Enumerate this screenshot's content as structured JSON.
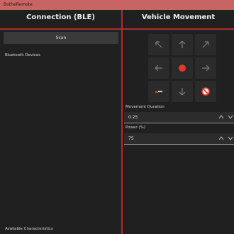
{
  "window": {
    "title": "BotheRemote"
  },
  "connection": {
    "title": "Connection (BLE)",
    "scan_label": "Scan",
    "devices_label": "Bluetooth Devices",
    "characteristics_label": "Available Characteristics"
  },
  "movement": {
    "title": "Vehicle Movement",
    "buttons": [
      {
        "icon": "arrow-up-left-icon"
      },
      {
        "icon": "arrow-up-icon"
      },
      {
        "icon": "arrow-up-right-icon"
      },
      {
        "icon": "arrow-left-icon"
      },
      {
        "icon": "stop-record-icon"
      },
      {
        "icon": "arrow-right-icon"
      },
      {
        "icon": "brush-icon"
      },
      {
        "icon": "arrow-down-icon"
      },
      {
        "icon": "no-entry-icon"
      }
    ],
    "duration_label": "Movement Duration",
    "duration_value": "0.25",
    "power_label": "Power (%)",
    "power_value": "75"
  },
  "colors": {
    "accent": "#b82a2a",
    "titlebar": "#c86464",
    "record_red": "#e03a2a"
  }
}
